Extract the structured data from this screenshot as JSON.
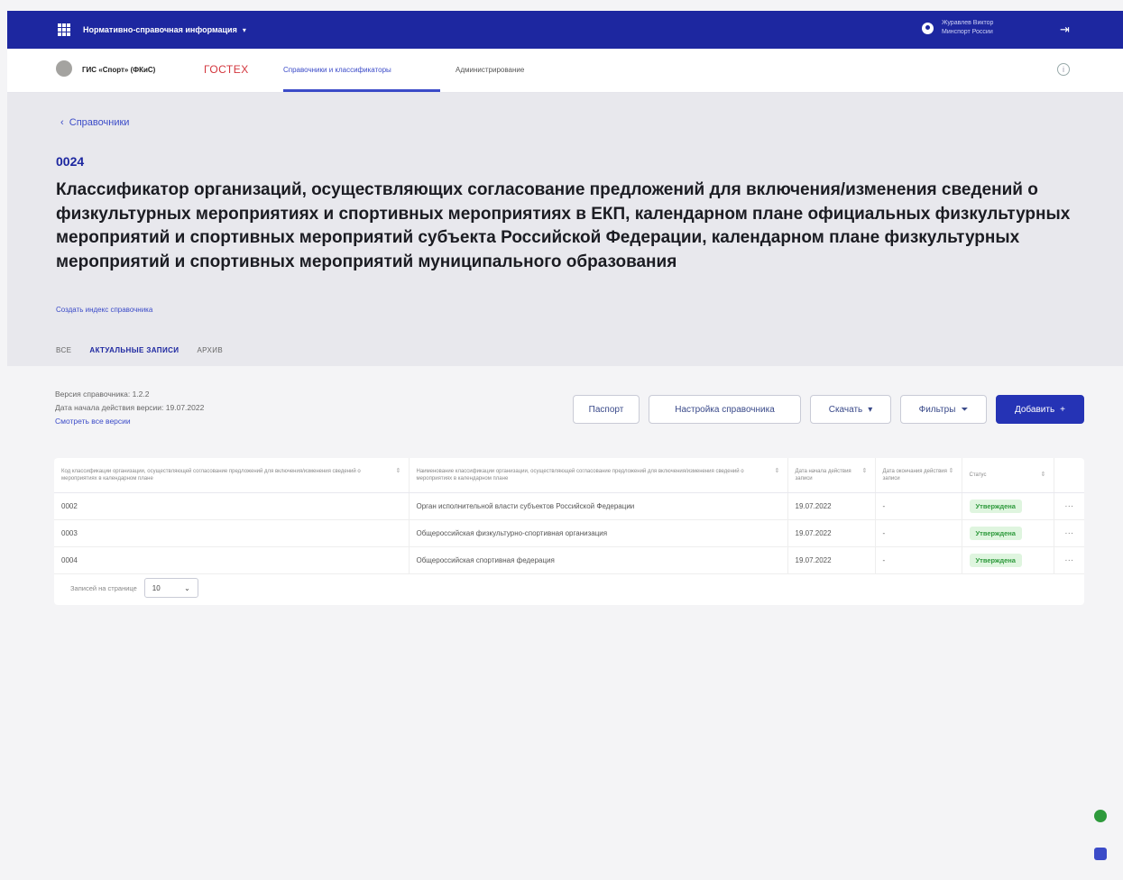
{
  "topbar": {
    "app_title": "Нормативно-справочная информация",
    "user_name": "Журавлев Виктор",
    "user_org": "Минспорт России"
  },
  "navbar": {
    "org_name": "ГИС «Спорт» (ФКиС)",
    "gostex": "ГОСТЕХ",
    "tabs": [
      {
        "label": "Справочники и классификаторы",
        "active": true
      },
      {
        "label": "Администрирование",
        "active": false
      }
    ]
  },
  "header": {
    "back_label": "Справочники",
    "code": "0024",
    "title": "Классификатор организаций, осуществляющих согласование предложений для включения/изменения сведений о физкультурных мероприятиях и спортивных мероприятиях в ЕКП, календарном плане официальных физкультурных мероприятий и спортивных мероприятий субъекта Российской Федерации, календарном плане физкультурных мероприятий и спортивных мероприятий муниципального образования",
    "index_link": "Создать индекс справочника",
    "tabs": [
      {
        "label": "ВСЕ",
        "active": false
      },
      {
        "label": "АКТУАЛЬНЫЕ ЗАПИСИ",
        "active": true
      },
      {
        "label": "АРХИВ",
        "active": false
      }
    ]
  },
  "version": {
    "version_label": "Версия справочника: 1.2.2",
    "start_date_label": "Дата начала действия версии: 19.07.2022",
    "all_versions_link": "Смотреть все версии"
  },
  "toolbar": {
    "passport": "Паспорт",
    "settings": "Настройка справочника",
    "download": "Скачать",
    "filters": "Фильтры",
    "add": "Добавить"
  },
  "table": {
    "headers": [
      "Код классификации организации, осуществляющей согласование предложений для включения/изменения сведений о мероприятиях в календарном плане",
      "Наименование классификации организации, осуществляющей согласование предложений для включения/изменения сведений о мероприятиях в календарном плане",
      "Дата начала действия записи",
      "Дата окончания действия записи",
      "Статус"
    ],
    "rows": [
      {
        "code": "0002",
        "name": "Орган исполнительной власти субъектов Российской Федерации",
        "start": "19.07.2022",
        "end": "-",
        "status": "Утверждена"
      },
      {
        "code": "0003",
        "name": "Общероссийская физкультурно-спортивная организация",
        "start": "19.07.2022",
        "end": "-",
        "status": "Утверждена"
      },
      {
        "code": "0004",
        "name": "Общероссийская спортивная федерация",
        "start": "19.07.2022",
        "end": "-",
        "status": "Утверждена"
      }
    ],
    "pager_label": "Записей на странице",
    "page_size": "10"
  }
}
